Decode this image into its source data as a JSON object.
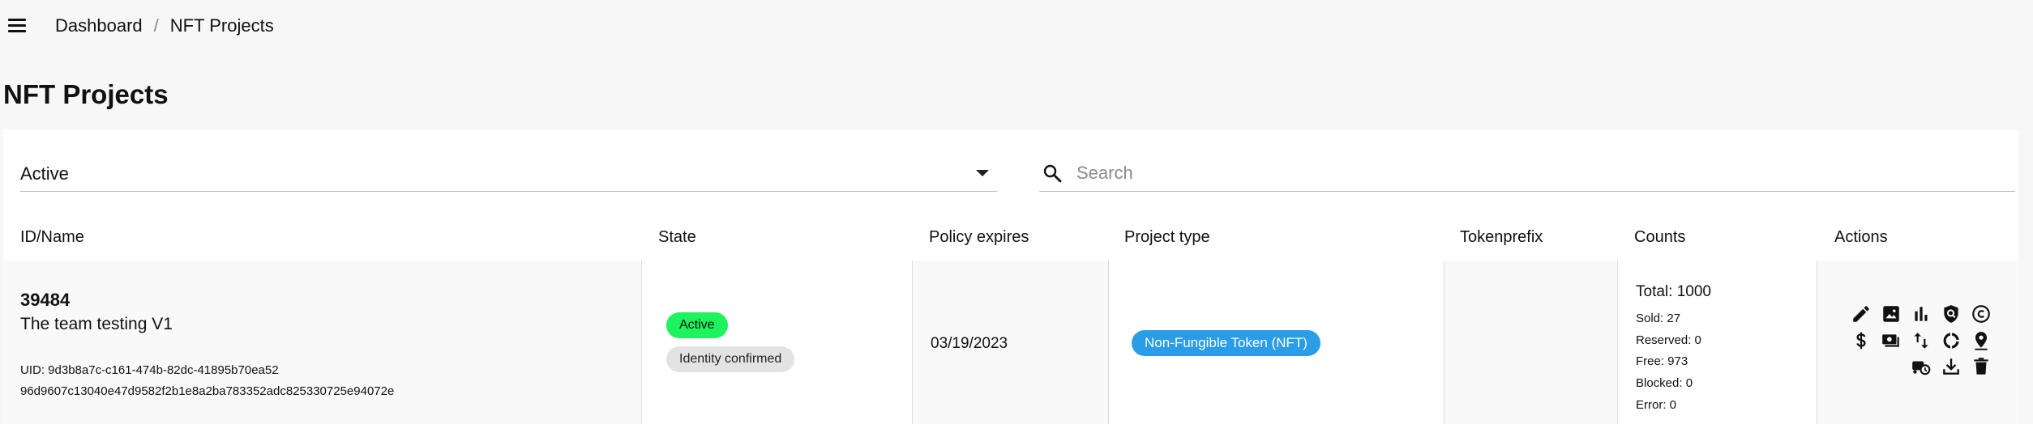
{
  "breadcrumb": {
    "home": "Dashboard",
    "separator": "/",
    "current": "NFT Projects"
  },
  "page": {
    "title": "NFT Projects"
  },
  "filters": {
    "state_value": "Active",
    "search_placeholder": "Search",
    "search_value": ""
  },
  "table": {
    "headers": {
      "id_name": "ID/Name",
      "state": "State",
      "policy_expires": "Policy expires",
      "project_type": "Project type",
      "tokenprefix": "Tokenprefix",
      "counts": "Counts",
      "actions": "Actions"
    },
    "rows": [
      {
        "id": "39484",
        "name": "The team testing V1",
        "uid": "UID: 9d3b8a7c-c161-474b-82dc-41895b70ea52",
        "hash": "96d9607c13040e47d9582f2b1e8a2ba783352adc825330725e94072e",
        "state_badge": "Active",
        "identity_badge": "Identity confirmed",
        "policy_expires": "03/19/2023",
        "project_type": "Non-Fungible Token (NFT)",
        "tokenprefix": "",
        "counts": {
          "total": "Total: 1000",
          "sold": "Sold: 27",
          "reserved": "Reserved: 0",
          "free": "Free: 973",
          "blocked": "Blocked: 0",
          "error": "Error: 0"
        },
        "actions": [
          "edit-icon",
          "image-icon",
          "bar-chart-icon",
          "policy-shield-icon",
          "copyright-icon",
          "dollar-icon",
          "payments-icon",
          "swap-vert-icon",
          "donut-icon",
          "location-pin-icon",
          "no-transfer-icon",
          "download-icon",
          "delete-icon"
        ]
      }
    ]
  },
  "colors": {
    "active_badge": "#1cf35d",
    "identity_badge": "#e3e3e3",
    "nft_badge": "#2b9ce7",
    "background": "#f7f7f7"
  }
}
